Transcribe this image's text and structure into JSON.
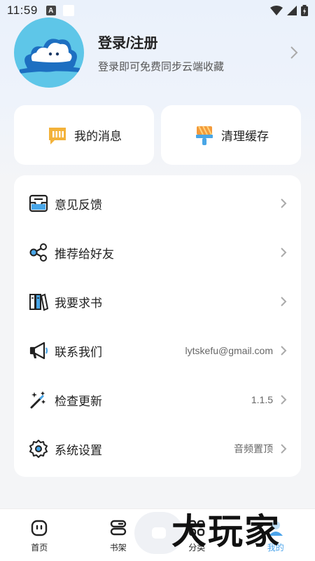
{
  "status_bar": {
    "time": "11:59",
    "notif_letter": "A"
  },
  "profile": {
    "title": "登录/注册",
    "subtitle": "登录即可免费同步云端收藏"
  },
  "cards": [
    {
      "label": "我的消息",
      "icon": "message-icon"
    },
    {
      "label": "清理缓存",
      "icon": "brush-icon"
    }
  ],
  "menu": [
    {
      "label": "意见反馈",
      "value": "",
      "icon": "feedback-icon"
    },
    {
      "label": "推荐给好友",
      "value": "",
      "icon": "share-icon"
    },
    {
      "label": "我要求书",
      "value": "",
      "icon": "books-icon"
    },
    {
      "label": "联系我们",
      "value": "lytskefu@gmail.com",
      "icon": "megaphone-icon"
    },
    {
      "label": "检查更新",
      "value": "1.1.5",
      "icon": "magic-wand-icon"
    },
    {
      "label": "系统设置",
      "value": "音频置顶",
      "icon": "gear-icon"
    }
  ],
  "bottom_nav": [
    {
      "label": "首页",
      "icon": "home-icon"
    },
    {
      "label": "书架",
      "icon": "bookshelf-icon"
    },
    {
      "label": "分类",
      "icon": "category-icon"
    },
    {
      "label": "我的",
      "icon": "user-icon",
      "active": true
    }
  ],
  "watermark": "大玩家",
  "colors": {
    "accent": "#4aa3ea",
    "avatar_bg": "#5ec6e8"
  }
}
